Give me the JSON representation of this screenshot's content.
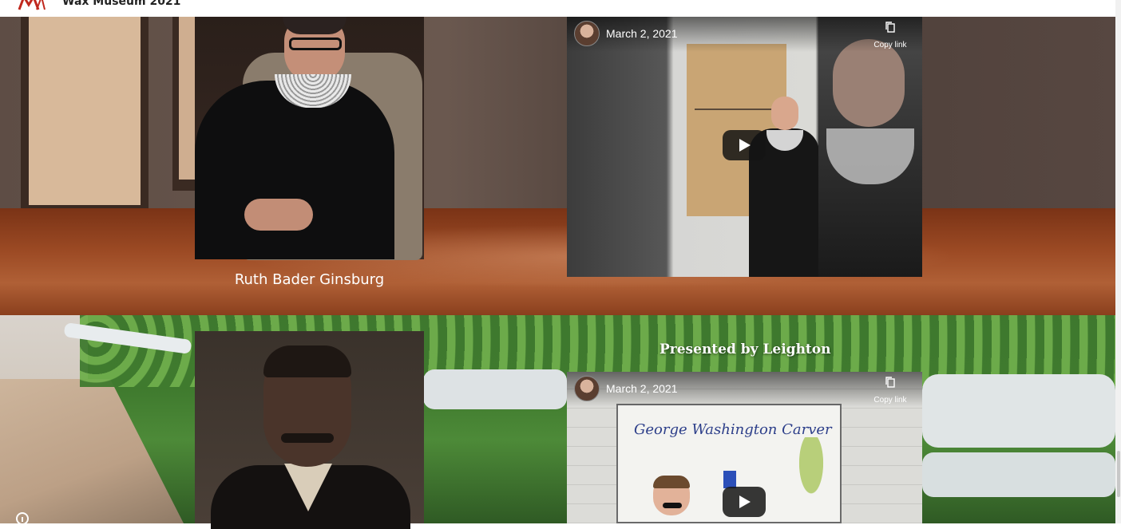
{
  "header": {
    "site_title": "Wax Museum 2021",
    "logo_icon": "museum-logo-icon"
  },
  "sections": [
    {
      "person": "Ruth Bader Ginsburg",
      "presenter_label": "",
      "video": {
        "date": "March 2, 2021",
        "copy_link": "Copy link",
        "play_icon": "play-icon",
        "copy_icon": "copy-icon"
      }
    },
    {
      "person": "",
      "presenter_label": "Presented by  Leighton",
      "video": {
        "date": "March 2, 2021",
        "copy_link": "Copy link",
        "board_text": "George Washington Carver",
        "play_icon": "play-icon",
        "copy_icon": "copy-icon"
      }
    }
  ],
  "colors": {
    "header_bg": "#ffffff",
    "logo_red": "#c0281e",
    "floor_brown": "#9c4a24",
    "video_black": "#111111"
  }
}
